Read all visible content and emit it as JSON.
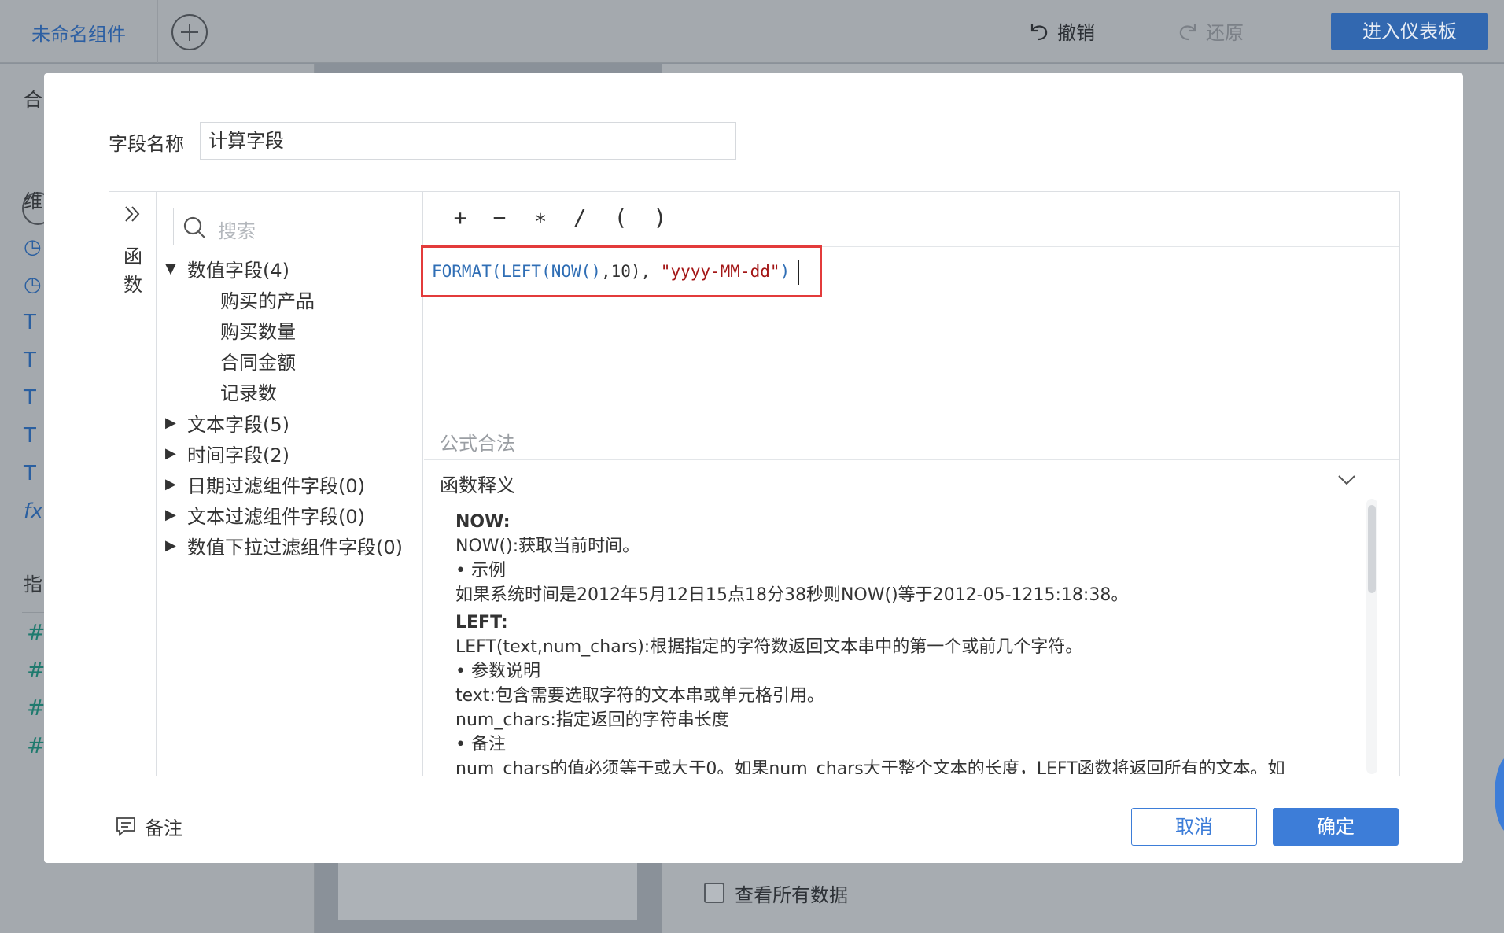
{
  "background": {
    "tab_name": "未命名组件",
    "undo_label": "撤销",
    "redo_label": "还原",
    "dashboard_button": "进入仪表板",
    "left_panel": {
      "section_1_partial": "合",
      "section_2_partial": "维",
      "section_3_partial": "指",
      "fx_icon": "fx"
    },
    "checkbox_label": "查看所有数据"
  },
  "dialog": {
    "field_name_label": "字段名称",
    "field_name_value": "计算字段",
    "fn_panel_label": "函数",
    "search_placeholder": "搜索",
    "tree": {
      "groups": [
        {
          "label": "数值字段(4)",
          "expanded": true
        },
        {
          "label": "文本字段(5)",
          "expanded": false
        },
        {
          "label": "时间字段(2)",
          "expanded": false
        },
        {
          "label": "日期过滤组件字段(0)",
          "expanded": false
        },
        {
          "label": "文本过滤组件字段(0)",
          "expanded": false
        },
        {
          "label": "数值下拉过滤组件字段(0)",
          "expanded": false
        }
      ],
      "numeric_fields": [
        "购买的产品",
        "购买数量",
        "合同金额",
        "记录数"
      ]
    },
    "operators": [
      "+",
      "−",
      "∗",
      "/",
      "(",
      ")"
    ],
    "formula": {
      "p1": "FORMAT(LEFT(NOW()",
      "p2": ",10), ",
      "p3": "\"yyyy-MM-dd\"",
      "p4": ")"
    },
    "validation_message": "公式合法",
    "explanation_title": "函数释义",
    "explanation": {
      "now_head": "NOW:",
      "now_desc": "NOW():获取当前时间。",
      "now_example_label": "• 示例",
      "now_example": "如果系统时间是2012年5月12日15点18分38秒则NOW()等于2012-05-1215:18:38。",
      "left_head": "LEFT:",
      "left_desc": "LEFT(text,num_chars):根据指定的字符数返回文本串中的第一个或前几个字符。",
      "left_params_label": "•  参数说明",
      "left_param_text": "text:包含需要选取字符的文本串或单元格引用。",
      "left_param_num": "num_chars:指定返回的字符串长度",
      "left_note_label": "•  备注",
      "left_note": "num_chars的值必须等于或大于0。如果num_chars大于整个文本的长度，LEFT函数将返回所有的文本。如"
    },
    "note_label": "备注",
    "cancel_label": "取消",
    "confirm_label": "确定"
  },
  "colors": {
    "accent": "#3d7dd8",
    "highlight_border": "#e33b3b",
    "function_text": "#2f6eb5",
    "string_text": "#a31515"
  }
}
